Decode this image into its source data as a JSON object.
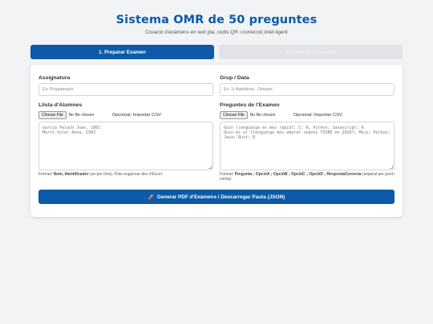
{
  "header": {
    "title": "Sistema OMR de 50 preguntes",
    "subtitle": "Creació d'exàmens en text pla, codis QR i correcció intel·ligent"
  },
  "tabs": [
    {
      "label": "1. Preparar Examen",
      "active": true
    },
    {
      "label": "2. Corregir (Escàner)",
      "active": false
    }
  ],
  "form": {
    "subject": {
      "label": "Assignatura",
      "placeholder": "Ex: Programació"
    },
    "group": {
      "label": "Grup / Data",
      "placeholder": "Ex: 1r Batxillerat - Octubre"
    },
    "students": {
      "label": "Llista d'Alumnes",
      "file_button": "Choose File",
      "file_status": "No file chosen",
      "optional": "Opcional: Importar CSV",
      "lines": [
        "Garcia Pelach Joan, 1001",
        "Martí Soler Anna, 1002"
      ],
      "help_prefix": "Format: ",
      "help_bold": "Nom, Identificador",
      "help_suffix": " (un per línia). Pots enganxar des d'Excel."
    },
    "questions": {
      "label": "Preguntes de l'Examen",
      "file_button": "Choose File",
      "file_status": "No file chosen",
      "optional": "Opcional: Importar CSV",
      "lines": [
        "Quin llenguatge és més ràpid?; C; R; Python; Javascript; A",
        "Quin és el llenguatge més emprat segons TIOBE en 2026?; Mojo; Python; Java; Rust; B"
      ],
      "help_prefix": "Format: ",
      "help_bold": "Pregunta ; OpcióA ; OpcióB ; OpcióC ; OpcióD ; RespostaCorrecta",
      "help_suffix": " (separat per punt i coma)."
    }
  },
  "generate_button": "Generar PDF d'Exàmens i Descarregar Pauta (JSON)",
  "colors": {
    "primary": "#0d5aa8",
    "inactive_tab": "#e1e3e6",
    "background": "#f1f3f5"
  },
  "icons": {
    "generate": "rocket-icon"
  }
}
